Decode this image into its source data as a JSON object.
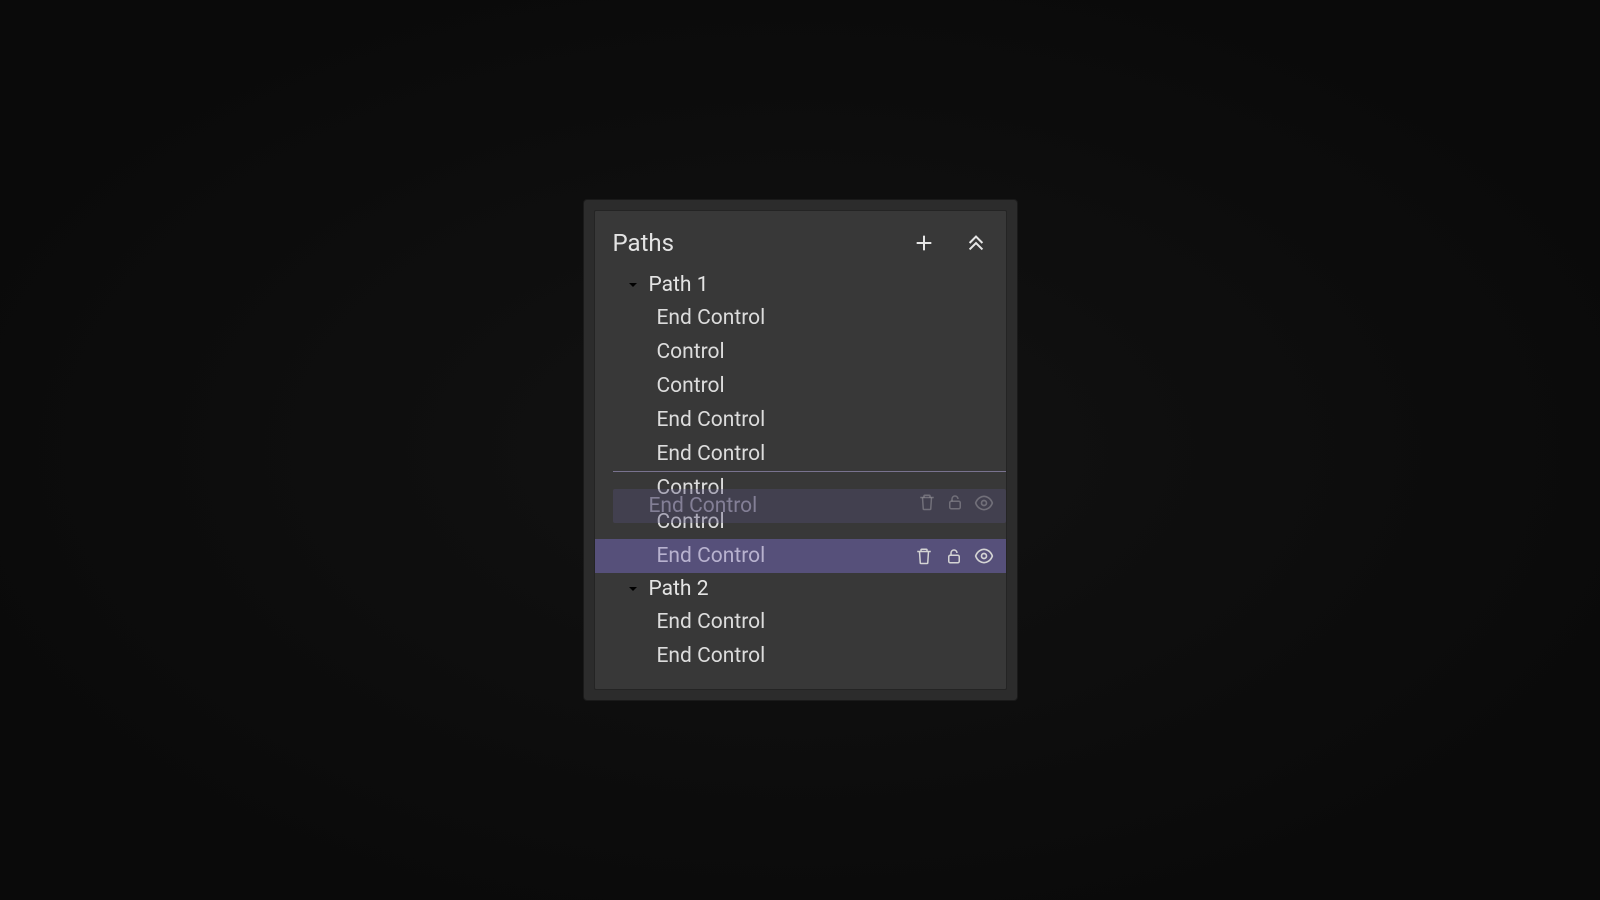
{
  "panel": {
    "title": "Paths",
    "add_btn": "add",
    "collapse_btn": "collapse-all"
  },
  "drag_ghost": {
    "label": "End Control"
  },
  "groups": [
    {
      "label": "Path 1",
      "expanded": true,
      "items": [
        {
          "label": "End Control",
          "selected": false,
          "drop_before": false
        },
        {
          "label": "Control",
          "selected": false,
          "drop_before": false
        },
        {
          "label": "Control",
          "selected": false,
          "drop_before": false
        },
        {
          "label": "End Control",
          "selected": false,
          "drop_before": false
        },
        {
          "label": "End Control",
          "selected": false,
          "drop_before": false
        },
        {
          "label": "Control",
          "selected": false,
          "drop_before": true
        },
        {
          "label": "Control",
          "selected": false,
          "drop_before": false
        },
        {
          "label": "End Control",
          "selected": true,
          "drop_before": false
        }
      ]
    },
    {
      "label": "Path 2",
      "expanded": true,
      "items": [
        {
          "label": "End Control",
          "selected": false,
          "drop_before": false
        },
        {
          "label": "End Control",
          "selected": false,
          "drop_before": false
        }
      ]
    }
  ]
}
